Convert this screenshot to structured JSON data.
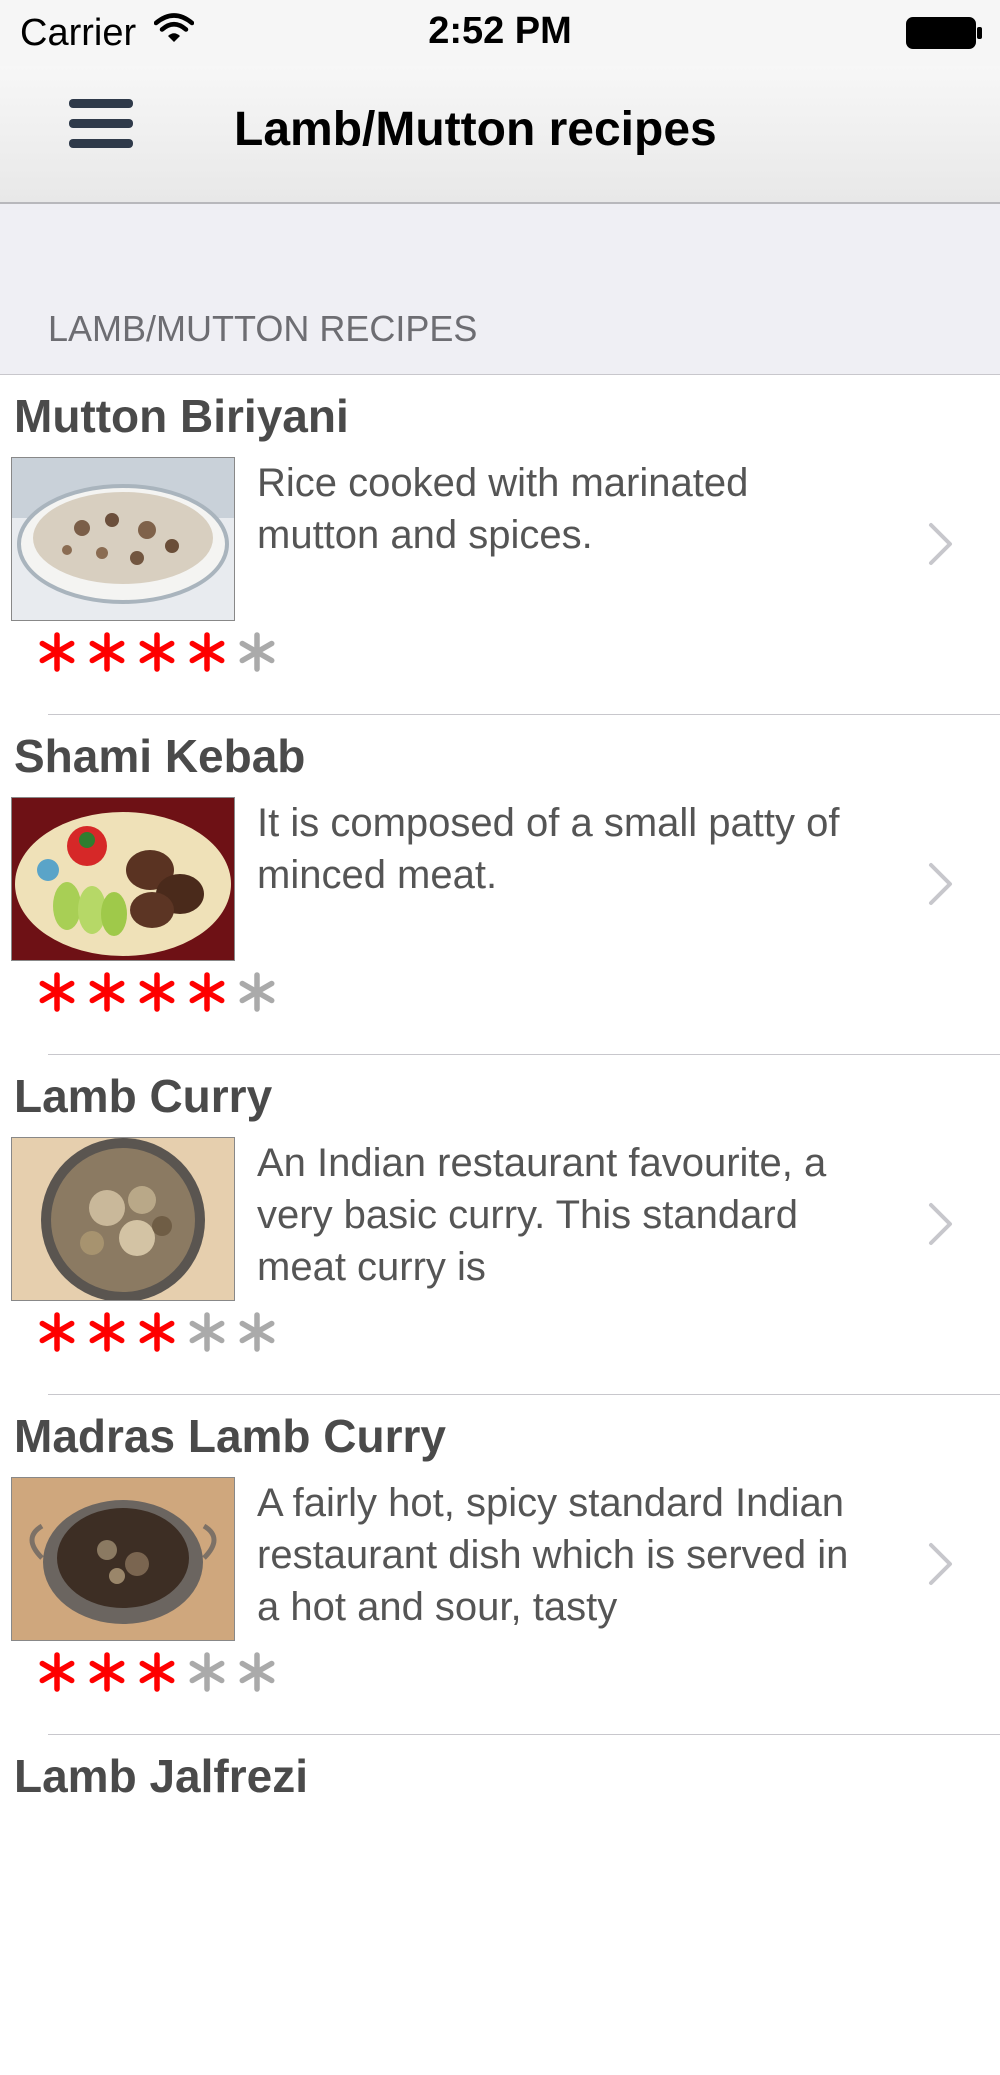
{
  "status_bar": {
    "carrier": "Carrier",
    "time": "2:52 PM",
    "icons": [
      "wifi-icon",
      "battery-icon"
    ]
  },
  "nav": {
    "title": "Lamb/Mutton recipes",
    "menu_icon": "hamburger-menu-icon"
  },
  "section": {
    "title": "LAMB/MUTTON RECIPES"
  },
  "colors": {
    "star_filled": "#ff0000",
    "star_empty": "#aaaaaa",
    "title_text": "#4a4a4a",
    "section_bg": "#efeff4"
  },
  "recipes": [
    {
      "title": "Mutton Biriyani",
      "description": "Rice cooked with marinated mutton and spices.",
      "rating": 4,
      "rating_max": 5,
      "image": "biriyani-photo"
    },
    {
      "title": "Shami Kebab",
      "description": "It is composed of a small patty of minced meat.",
      "rating": 4,
      "rating_max": 5,
      "image": "kebab-photo"
    },
    {
      "title": "Lamb Curry",
      "description": "An Indian restaurant favourite, a very basic curry. This standard meat curry is",
      "rating": 3,
      "rating_max": 5,
      "image": "lamb-curry-photo"
    },
    {
      "title": "Madras Lamb Curry",
      "description": "A fairly hot, spicy standard Indian restaurant dish which is served in a hot and sour, tasty",
      "rating": 3,
      "rating_max": 5,
      "image": "madras-curry-photo"
    },
    {
      "title": "Lamb Jalfrezi",
      "description": "",
      "rating": 0,
      "rating_max": 5,
      "image": "jalfrezi-photo"
    }
  ]
}
